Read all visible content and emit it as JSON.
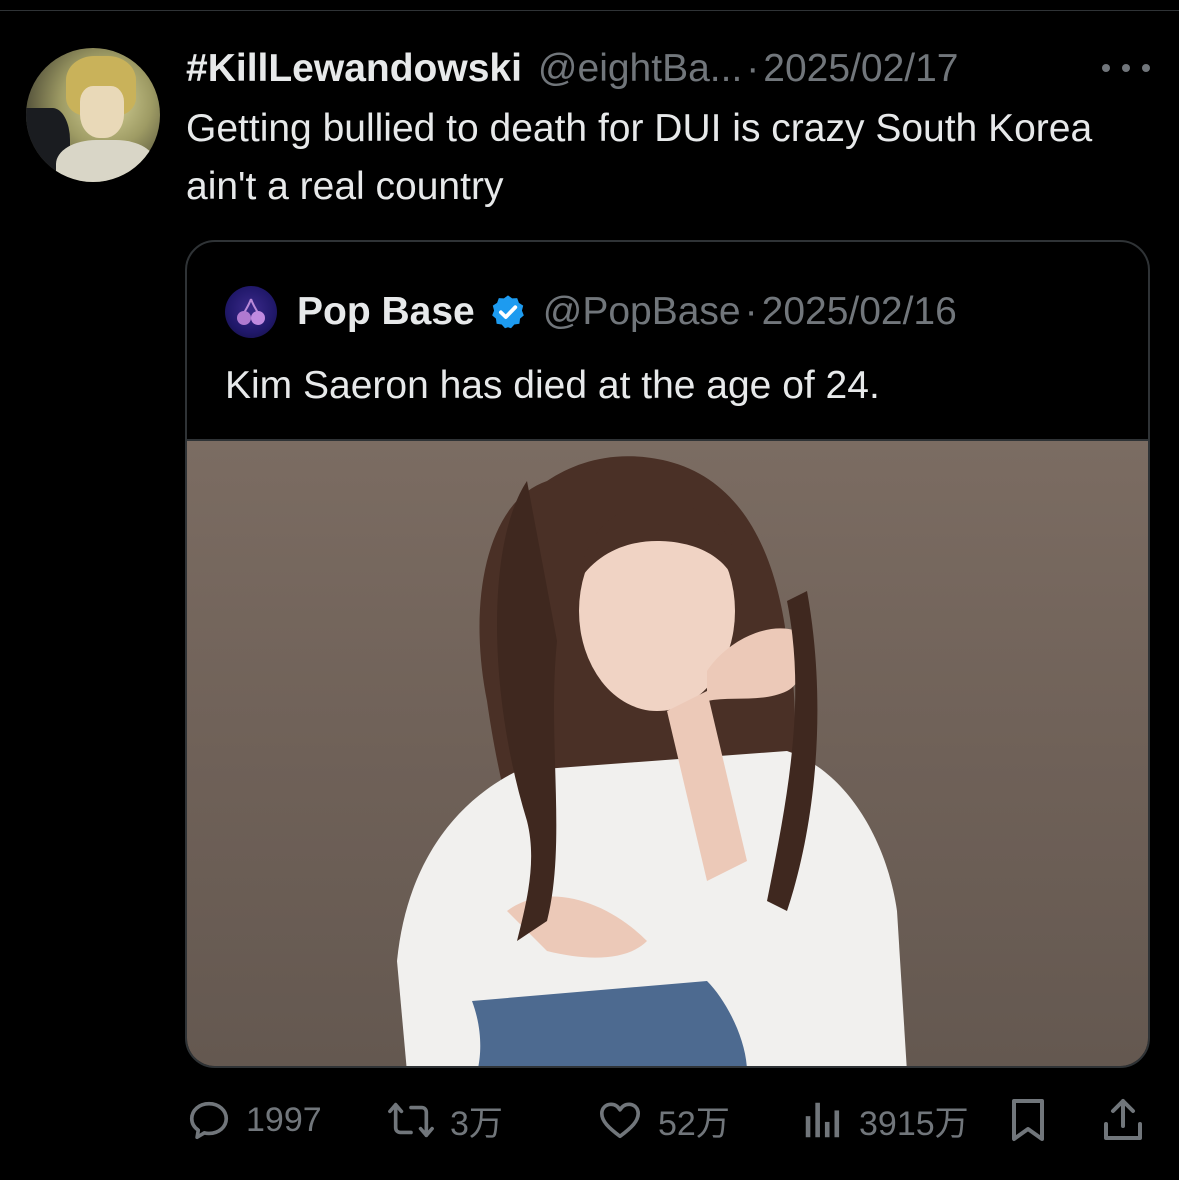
{
  "tweet": {
    "display_name": "#KillLewandowski",
    "handle": "@eightBa...",
    "separator": "·",
    "date": "2025/02/17",
    "text": "Getting bullied to death for DUI is crazy South Korea ain't a real country",
    "more_icon": "more-horizontal-icon",
    "avatar": "anime-character-avatar"
  },
  "quote": {
    "display_name": "Pop Base",
    "verified_icon": "verified-badge-icon",
    "handle": "@PopBase",
    "separator": "·",
    "date": "2025/02/16",
    "text": "Kim Saeron has died at the age of 24.",
    "avatar": "cherry-logo-avatar",
    "image": "portrait-photo"
  },
  "actions": {
    "replies": {
      "icon": "reply-icon",
      "count": "1997"
    },
    "reposts": {
      "icon": "repost-icon",
      "count": "3万"
    },
    "likes": {
      "icon": "heart-icon",
      "count": "52万"
    },
    "views": {
      "icon": "views-chart-icon",
      "count": "3915万"
    },
    "bookmark": {
      "icon": "bookmark-icon"
    },
    "share": {
      "icon": "share-icon"
    }
  },
  "colors": {
    "background": "#000000",
    "text_primary": "#e7e9ea",
    "text_secondary": "#71767b",
    "border": "#2f3336",
    "verified_blue": "#1d9bf0"
  }
}
